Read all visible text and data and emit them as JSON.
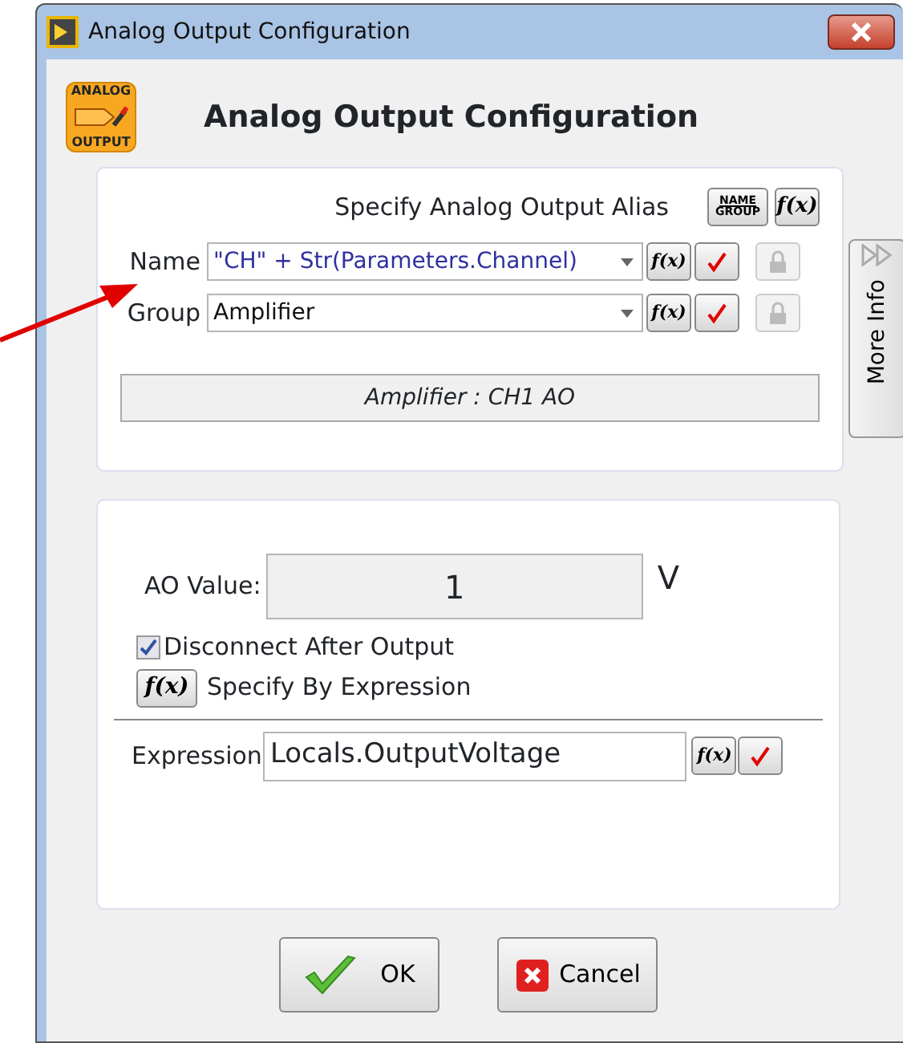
{
  "window": {
    "title": "Analog Output Configuration"
  },
  "header": {
    "icon_top": "ANALOG",
    "icon_bottom": "OUTPUT",
    "title": "Analog Output Configuration"
  },
  "alias": {
    "heading": "Specify Analog Output Alias",
    "name_group_button": {
      "top": "NAME",
      "bottom": "GROUP"
    },
    "fx_button": "f(x)",
    "fields": [
      {
        "label": "Name",
        "value": "\"CH\" + Str(Parameters.Channel)",
        "fx": "f(x)"
      },
      {
        "label": "Group",
        "value": "Amplifier",
        "fx": "f(x)"
      }
    ],
    "preview": "Amplifier : CH1 AO"
  },
  "more_info": "More Info",
  "output": {
    "value_label": "AO Value:",
    "value": "1",
    "unit": "V",
    "disconnect": {
      "label": "Disconnect After Output",
      "checked": true
    },
    "specify_button": "f(x)",
    "specify_label": "Specify By Expression",
    "expression_label": "Expression",
    "expression": "Locals.OutputVoltage",
    "expression_fx": "f(x)"
  },
  "buttons": [
    {
      "label": "OK",
      "kind": "ok"
    },
    {
      "label": "Cancel",
      "kind": "cancel"
    }
  ]
}
